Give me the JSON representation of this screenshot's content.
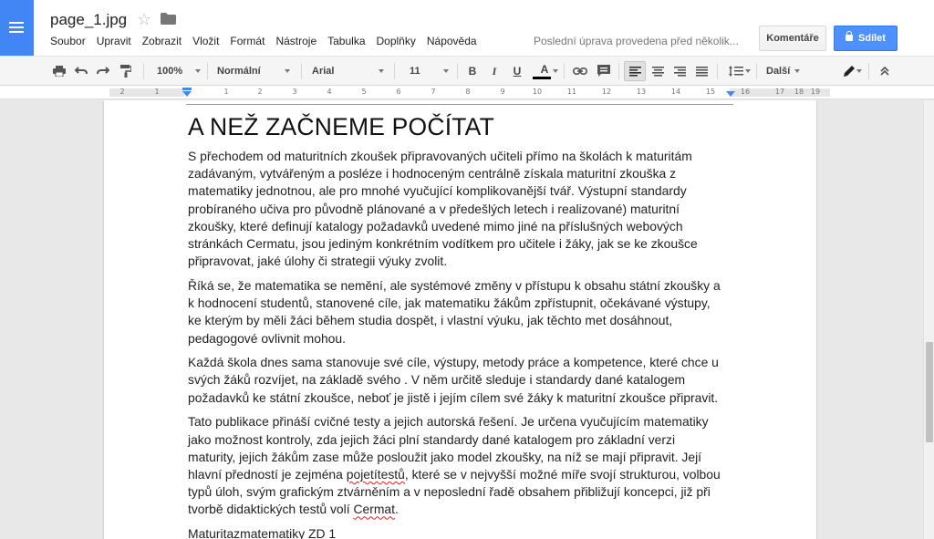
{
  "header": {
    "doc_title": "page_1.jpg",
    "menu": [
      "Soubor",
      "Upravit",
      "Zobrazit",
      "Vložit",
      "Formát",
      "Nástroje",
      "Tabulka",
      "Doplňky",
      "Nápověda"
    ],
    "last_edit": "Poslední úprava provedena před několik...",
    "comments_label": "Komentáře",
    "share_label": "Sdílet",
    "colors": {
      "logo": "#4285f4",
      "share_button": "#4d90fe"
    }
  },
  "toolbar": {
    "zoom": "100%",
    "style": "Normální",
    "font": "Arial",
    "size": "11",
    "bold": "B",
    "italic": "I",
    "underline": "U",
    "text_color": "A",
    "more": "Další"
  },
  "ruler": {
    "labels": [
      "2",
      "1",
      "1",
      "2",
      "3",
      "4",
      "5",
      "6",
      "7",
      "8",
      "9",
      "10",
      "11",
      "12",
      "13",
      "14",
      "15",
      "16",
      "17",
      "18",
      "19"
    ]
  },
  "document": {
    "heading": "A NEŽ ZAČNEME POČÍTAT",
    "p1": [
      "S přechodem od maturitních zkoušek připravovaných učiteli přímo na školách k maturitám",
      "zadávaným, vytvářeným a posléze i hodnoceným centrálně získala maturitní zkouška z",
      "matematiky jednotnou, ale pro mnohé vyučující komplikovanější tvář. Výstupní standardy",
      "probíraného učiva pro původně plánované a v předešlých letech i realizované) maturitní",
      "zkoušky, které definují katalogy požadavků uvedené mimo jiné na příslušných webových",
      "stránkách Cermatu, jsou jediným konkrétním vodítkem pro učitele i žáky, jak se ke zkoušce",
      "připravovat, jaké úlohy či strategii výuky zvolit."
    ],
    "p2": [
      "Říká se, že matematika se nemění, ale systémové změny v přístupu k obsahu státní zkoušky a",
      "k hodnocení studentů, stanovené cíle, jak matematiku žákům zpřístupnit, očekávané výstupy,",
      "ke kterým by měli žáci během studia dospět, i vlastní výuku, jak těchto met dosáhnout,",
      "pedagogové ovlivnit mohou."
    ],
    "p3": [
      "Každá škola dnes sama stanovuje své cíle, výstupy, metody práce a kompetence, které chce u",
      "svých žáků rozvíjet, na základě svého . V něm určitě sleduje i standardy dané katalogem",
      "požadavků ke státní zkoušce, neboť je jistě i jejím cílem své žáky k maturitní zkoušce připravit."
    ],
    "p4": [
      "Tato publikace přináší cvičné testy a jejich autorská řešení. Je určena vyučujícím matematiky",
      "jako možnost kontroly, zda jejich žáci plní standardy dané katalogem pro základní verzi",
      "maturity, jejich žákům zase může posloužit jako model zkoušky, na níž se mají připravit. Její"
    ],
    "p4_l4_before": "hlavní předností je zejména ",
    "p4_l4_spell": "pojetítestů",
    "p4_l4_after": ", které se v nejvyšší možné míře svojí strukturou, volbou",
    "p4_l5": "typů úloh, svým grafickým ztvárněním a v neposlední řadě obsahem přibližují koncepci, již při",
    "p4_l6_before": "tvorbě didaktických testů volí ",
    "p4_l6_spell": "Cermat",
    "p4_l6_after": ".",
    "footer": "Maturitazmatematiky ZD 1"
  }
}
